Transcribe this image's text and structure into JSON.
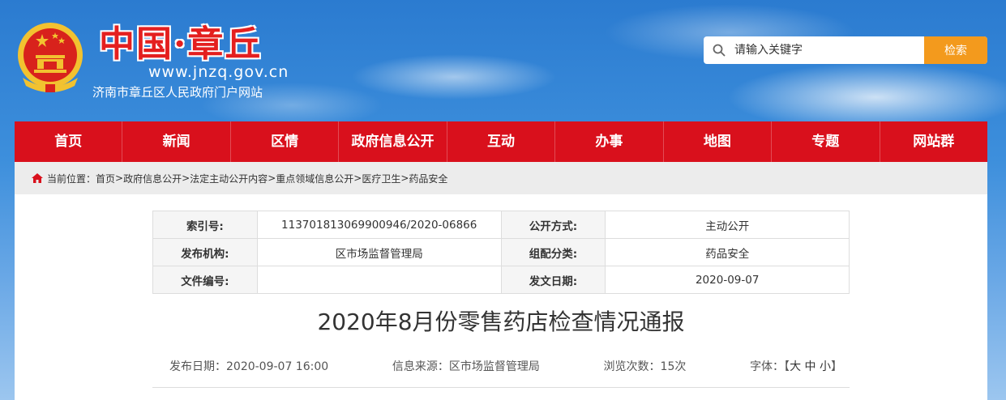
{
  "header": {
    "logo_text": "中国·章丘",
    "logo_url": "www.jnzq.gov.cn",
    "site_name": "济南市章丘区人民政府门户网站",
    "search_placeholder": "请输入关键字",
    "search_button": "检索"
  },
  "nav": [
    "首页",
    "新闻",
    "区情",
    "政府信息公开",
    "互动",
    "办事",
    "地图",
    "专题",
    "网站群"
  ],
  "breadcrumb": {
    "label": "当前位置：",
    "items": [
      "首页",
      "政府信息公开",
      "法定主动公开内容",
      "重点领域信息公开",
      "医疗卫生",
      "药品安全"
    ],
    "separator": ">"
  },
  "meta": {
    "index_label": "索引号:",
    "index_value": "113701813069900946/2020-06866",
    "method_label": "公开方式:",
    "method_value": "主动公开",
    "publisher_label": "发布机构:",
    "publisher_value": "区市场监督管理局",
    "category_label": "组配分类:",
    "category_value": "药品安全",
    "doc_no_label": "文件编号:",
    "doc_no_value": "",
    "date_label": "发文日期:",
    "date_value": "2020-09-07"
  },
  "article": {
    "title": "2020年8月份零售药店检查情况通报",
    "publish_date": "发布日期：2020-09-07 16:00",
    "source": "信息来源：区市场监督管理局",
    "views": "浏览次数：15次",
    "font_label": "字体：【",
    "font_large": "大",
    "font_medium": "中",
    "font_small": "小",
    "font_close": "】"
  },
  "colors": {
    "nav_red": "#d9101c",
    "search_orange": "#f39a1d",
    "logo_red": "#e41f1f"
  }
}
